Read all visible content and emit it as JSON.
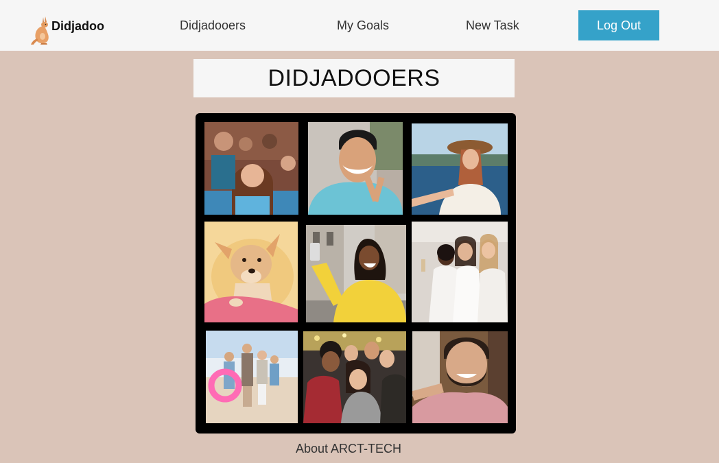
{
  "header": {
    "logo_text": "Didjadoo",
    "logo_icon": "kangaroo-icon",
    "nav": [
      "Didjadooers",
      "My Goals",
      "New Task"
    ],
    "logout_label": "Log Out"
  },
  "main": {
    "title": "DIDJADOOERS",
    "photos": [
      "group-selfie-friends",
      "smiling-man-peace-sign",
      "woman-hat-seaside",
      "dog-on-pillow",
      "woman-yellow-sweater-selfie",
      "three-women-champagne",
      "family-on-beach",
      "party-group-selfie",
      "bearded-man-selfie"
    ]
  },
  "footer": {
    "about": "About ARCT-TECH"
  },
  "colors": {
    "background": "#dac4b8",
    "navbar": "#f6f6f6",
    "accent": "#35a2c9"
  }
}
